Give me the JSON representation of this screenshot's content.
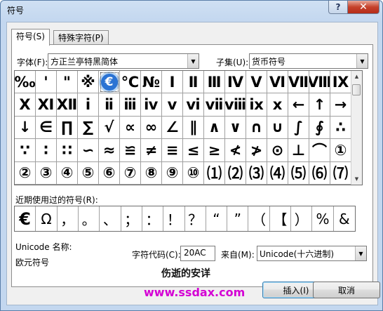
{
  "window": {
    "title": "符号",
    "help_label": "?",
    "close_label": "✕"
  },
  "tabs": [
    {
      "label": "符号(S)",
      "active": true
    },
    {
      "label": "特殊字符(P)",
      "active": false
    }
  ],
  "font": {
    "label": "字体(F):",
    "value": "方正兰亭特黑简体"
  },
  "subset": {
    "label": "子集(U):",
    "value": "货币符号"
  },
  "symbols": [
    "‰",
    "'",
    "\"",
    "※",
    "€",
    "℃",
    "№",
    "Ⅰ",
    "Ⅱ",
    "Ⅲ",
    "Ⅳ",
    "Ⅴ",
    "Ⅵ",
    "Ⅶ",
    "Ⅷ",
    "Ⅸ",
    "Ⅹ",
    "Ⅺ",
    "Ⅻ",
    "ⅰ",
    "ⅱ",
    "ⅲ",
    "ⅳ",
    "ⅴ",
    "ⅵ",
    "ⅶ",
    "ⅷ",
    "ⅸ",
    "ⅹ",
    "←",
    "↑",
    "→",
    "↓",
    "∈",
    "∏",
    "∑",
    "√",
    "∝",
    "∞",
    "∠",
    "∥",
    "∧",
    "∨",
    "∩",
    "∪",
    "∫",
    "∮",
    "∴",
    "∵",
    "∶",
    "∷",
    "∽",
    "≈",
    "≌",
    "≠",
    "≡",
    "≤",
    "≥",
    "≮",
    "≯",
    "⊙",
    "⊥",
    "⌒",
    "①",
    "②",
    "③",
    "④",
    "⑤",
    "⑥",
    "⑦",
    "⑧",
    "⑨",
    "⑩",
    "⑴",
    "⑵",
    "⑶",
    "⑷",
    "⑸",
    "⑹",
    "⑺"
  ],
  "selected_index": 4,
  "recent": {
    "label": "近期使用过的符号(R):",
    "items": [
      "€",
      "Ω",
      "，",
      "。",
      "、",
      "；",
      "：",
      "！",
      "？",
      "“",
      "”",
      "（",
      "【",
      "）",
      "%",
      "&"
    ]
  },
  "unicode_name": {
    "label": "Unicode 名称:",
    "value": "欧元符号"
  },
  "char_code": {
    "label": "字符代码(C):",
    "value": "20AC"
  },
  "from": {
    "label": "来自(M):",
    "value": "Unicode(十六进制)"
  },
  "buttons": {
    "insert": "插入(I)",
    "cancel": "取消"
  },
  "watermark": {
    "line1": "伤逝的安详",
    "line2": "www.ssdax.com"
  }
}
